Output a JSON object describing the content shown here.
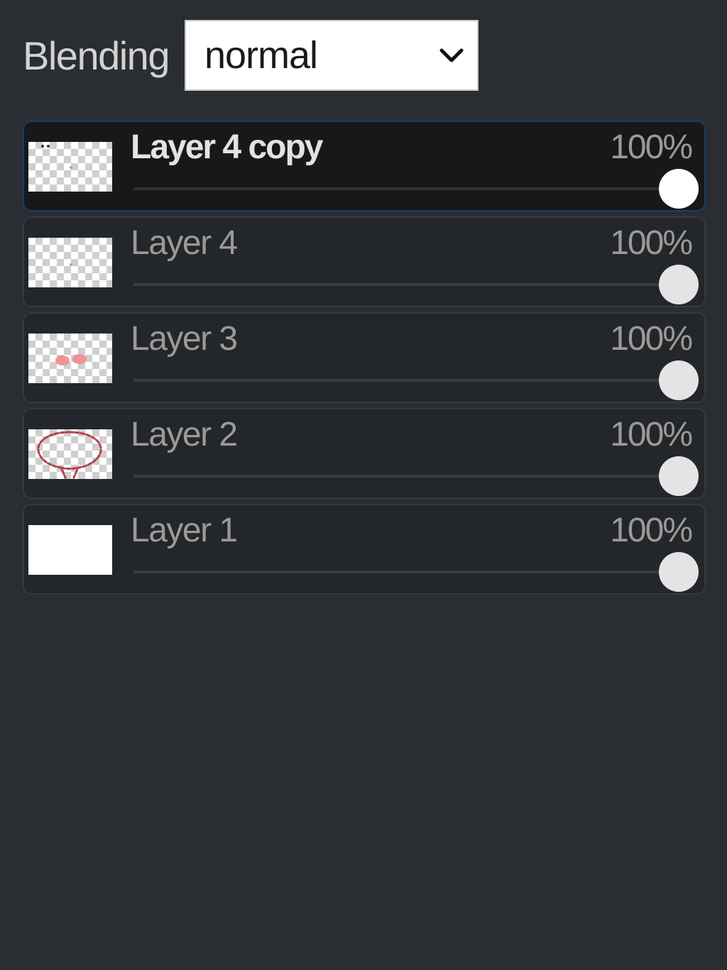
{
  "blending": {
    "label": "Blending",
    "selected": "normal"
  },
  "layers": [
    {
      "name": "Layer 4 copy",
      "opacity": "100%",
      "opacity_value": 1.0,
      "active": true,
      "thumb": "transparent-dots"
    },
    {
      "name": "Layer 4",
      "opacity": "100%",
      "opacity_value": 1.0,
      "active": false,
      "thumb": "transparent-dots"
    },
    {
      "name": "Layer 3",
      "opacity": "100%",
      "opacity_value": 1.0,
      "active": false,
      "thumb": "pink-blush"
    },
    {
      "name": "Layer 2",
      "opacity": "100%",
      "opacity_value": 1.0,
      "active": false,
      "thumb": "red-outline"
    },
    {
      "name": "Layer 1",
      "opacity": "100%",
      "opacity_value": 1.0,
      "active": false,
      "thumb": "white-fill"
    }
  ],
  "colors": {
    "background": "#2a2d31",
    "active_border": "#1b3c6e"
  }
}
